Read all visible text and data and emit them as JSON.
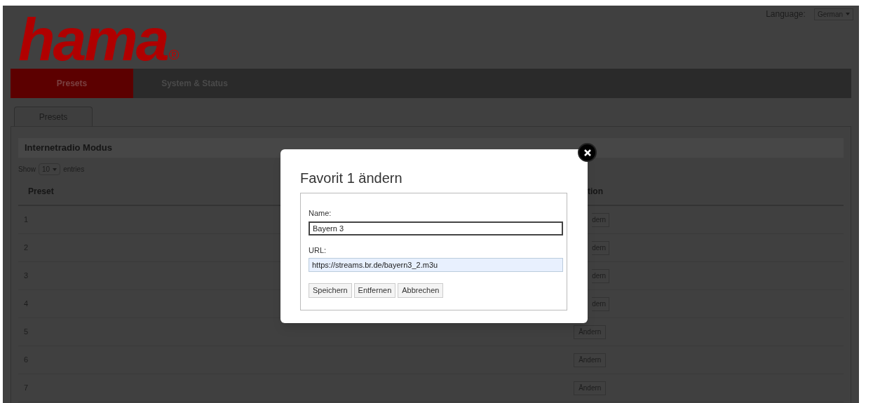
{
  "header": {
    "logo": "hama",
    "registered_mark": "®",
    "language_label": "Language:",
    "language_value": "German"
  },
  "nav": [
    {
      "label": "Presets",
      "selected": true
    },
    {
      "label": "System & Status",
      "selected": false
    }
  ],
  "tabs": [
    {
      "label": "Presets",
      "selected": true
    }
  ],
  "section": {
    "title": "Internetradio Modus",
    "show_label": "Show",
    "entries_value": "10",
    "entries_label": "entries",
    "columns": [
      "Preset",
      "tion"
    ],
    "rows": [
      {
        "preset": "1",
        "action": "dern",
        "covered": true
      },
      {
        "preset": "2",
        "action": "dern",
        "covered": true
      },
      {
        "preset": "3",
        "action": "dern",
        "covered": true
      },
      {
        "preset": "4",
        "action": "dern",
        "covered": true
      },
      {
        "preset": "5",
        "action": "Ändern",
        "covered": false
      },
      {
        "preset": "6",
        "action": "Ändern",
        "covered": false
      },
      {
        "preset": "7",
        "action": "Ändern",
        "covered": false
      }
    ]
  },
  "dialog": {
    "title": "Favorit 1 ändern",
    "name_label": "Name:",
    "name_value": "Bayern 3",
    "url_label": "URL:",
    "url_value": "https://streams.br.de/bayern3_2.m3u",
    "buttons": [
      "Speichern",
      "Entfernen",
      "Abbrechen"
    ]
  }
}
